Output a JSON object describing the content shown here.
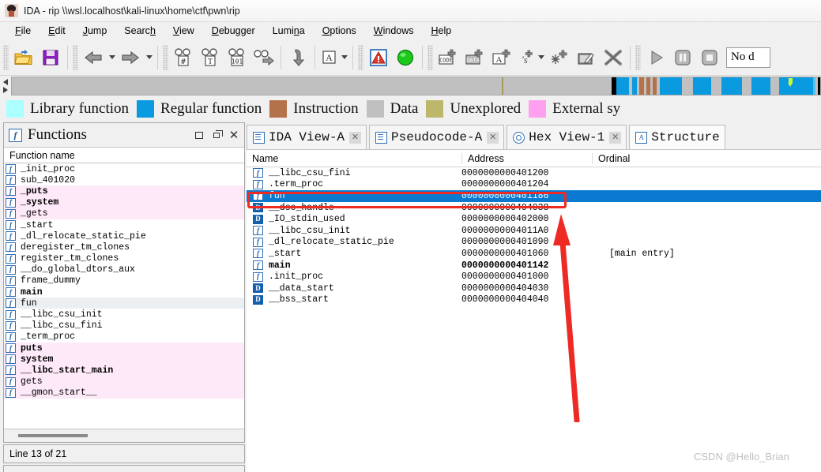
{
  "window": {
    "title": "IDA - rip \\\\wsl.localhost\\kali-linux\\home\\ctf\\pwn\\rip",
    "logo_icon": "ida-app-icon"
  },
  "menubar": [
    {
      "label": "File",
      "mnemonic": "F"
    },
    {
      "label": "Edit",
      "mnemonic": "E"
    },
    {
      "label": "Jump",
      "mnemonic": "J"
    },
    {
      "label": "Search",
      "mnemonic": "h"
    },
    {
      "label": "View",
      "mnemonic": "V"
    },
    {
      "label": "Debugger",
      "mnemonic": "D"
    },
    {
      "label": "Lumina",
      "mnemonic": "n"
    },
    {
      "label": "Options",
      "mnemonic": "O"
    },
    {
      "label": "Windows",
      "mnemonic": "W"
    },
    {
      "label": "Help",
      "mnemonic": "H"
    }
  ],
  "toolbar": {
    "buttons": [
      "open-file-icon",
      "save-file-icon",
      "navigate-back-icon",
      "navigate-forward-icon",
      "search-hex-icon",
      "search-text-icon",
      "search-immediate-icon",
      "search-next-icon",
      "jump-down-icon",
      "ascii-string-icon",
      "warning-icon",
      "green-run-icon",
      "make-code-icon",
      "make-data-icon",
      "make-ascii-icon",
      "make-struct-var-icon",
      "make-struct-icon",
      "edit-function-icon",
      "delete-icon",
      "run-icon",
      "pause-icon",
      "stop-icon"
    ],
    "debugger_selector": "No d"
  },
  "navigation": {
    "segments": [
      {
        "left": 0.0,
        "width": 60.6,
        "color": "#c0c0c0"
      },
      {
        "left": 60.6,
        "width": 0.25,
        "color": "#a89a5c"
      },
      {
        "left": 60.85,
        "width": 13.3,
        "color": "#c0c0c0"
      },
      {
        "left": 74.15,
        "width": 0.62,
        "color": "#000000"
      },
      {
        "left": 74.77,
        "width": 1.55,
        "color": "#0a9ae0"
      },
      {
        "left": 76.32,
        "width": 0.4,
        "color": "#c0c0c0"
      },
      {
        "left": 76.72,
        "width": 0.62,
        "color": "#0a9ae0"
      },
      {
        "left": 77.34,
        "width": 0.32,
        "color": "#c0c0c0"
      },
      {
        "left": 77.66,
        "width": 0.5,
        "color": "#b5714a"
      },
      {
        "left": 78.16,
        "width": 0.31,
        "color": "#c0c0c0"
      },
      {
        "left": 78.47,
        "width": 0.5,
        "color": "#b5714a"
      },
      {
        "left": 78.97,
        "width": 0.31,
        "color": "#c0c0c0"
      },
      {
        "left": 79.28,
        "width": 0.5,
        "color": "#b5714a"
      },
      {
        "left": 79.78,
        "width": 0.4,
        "color": "#c0c0c0"
      },
      {
        "left": 80.18,
        "width": 2.7,
        "color": "#0a9ae0"
      },
      {
        "left": 82.88,
        "width": 1.35,
        "color": "#c0c0c0"
      },
      {
        "left": 84.23,
        "width": 2.3,
        "color": "#0a9ae0"
      },
      {
        "left": 86.53,
        "width": 1.25,
        "color": "#c0c0c0"
      },
      {
        "left": 87.78,
        "width": 2.5,
        "color": "#0a9ae0"
      },
      {
        "left": 90.28,
        "width": 1.25,
        "color": "#c0c0c0"
      },
      {
        "left": 91.53,
        "width": 2.3,
        "color": "#0a9ae0"
      },
      {
        "left": 93.83,
        "width": 1.1,
        "color": "#c0c0c0"
      },
      {
        "left": 94.93,
        "width": 4.2,
        "color": "#0a9ae0"
      },
      {
        "left": 99.13,
        "width": 0.3,
        "color": "#4fc3f0"
      },
      {
        "left": 99.43,
        "width": 0.3,
        "color": "#c0c0c0"
      },
      {
        "left": 99.73,
        "width": 0.27,
        "color": "#000000"
      }
    ],
    "cursor_percent": 96.0,
    "tail_color": "#bdb76b",
    "tail_start_percent": 100.0
  },
  "legend": [
    {
      "label": "Library function",
      "color": "#aaffff"
    },
    {
      "label": "Regular function",
      "color": "#0a9ae0"
    },
    {
      "label": "Instruction",
      "color": "#b5714a"
    },
    {
      "label": "Data",
      "color": "#c0c0c0"
    },
    {
      "label": "Unexplored",
      "color": "#bdb76b"
    },
    {
      "label": "External sy",
      "color": "#ff9ff0"
    }
  ],
  "functions_panel": {
    "title": "Functions",
    "icon": "functions-window-icon",
    "column_header": "Function name",
    "window_buttons": [
      "minimize-button",
      "restore-button",
      "close-button"
    ],
    "items": [
      {
        "name": "_init_proc",
        "import": false,
        "bold": false,
        "selected": false
      },
      {
        "name": "sub_401020",
        "import": false,
        "bold": false,
        "selected": false
      },
      {
        "name": "_puts",
        "import": true,
        "bold": true,
        "selected": false
      },
      {
        "name": "_system",
        "import": true,
        "bold": true,
        "selected": false
      },
      {
        "name": "_gets",
        "import": true,
        "bold": false,
        "selected": false
      },
      {
        "name": "_start",
        "import": false,
        "bold": false,
        "selected": false
      },
      {
        "name": "_dl_relocate_static_pie",
        "import": false,
        "bold": false,
        "selected": false
      },
      {
        "name": "deregister_tm_clones",
        "import": false,
        "bold": false,
        "selected": false
      },
      {
        "name": "register_tm_clones",
        "import": false,
        "bold": false,
        "selected": false
      },
      {
        "name": "__do_global_dtors_aux",
        "import": false,
        "bold": false,
        "selected": false
      },
      {
        "name": "frame_dummy",
        "import": false,
        "bold": false,
        "selected": false
      },
      {
        "name": "main",
        "import": false,
        "bold": true,
        "selected": false
      },
      {
        "name": "fun",
        "import": false,
        "bold": false,
        "selected": true
      },
      {
        "name": "__libc_csu_init",
        "import": false,
        "bold": false,
        "selected": false
      },
      {
        "name": "__libc_csu_fini",
        "import": false,
        "bold": false,
        "selected": false
      },
      {
        "name": "_term_proc",
        "import": false,
        "bold": false,
        "selected": false
      },
      {
        "name": "puts",
        "import": true,
        "bold": true,
        "selected": false
      },
      {
        "name": "system",
        "import": true,
        "bold": true,
        "selected": false
      },
      {
        "name": "__libc_start_main",
        "import": true,
        "bold": true,
        "selected": false
      },
      {
        "name": "gets",
        "import": true,
        "bold": false,
        "selected": false
      },
      {
        "name": "__gmon_start__",
        "import": true,
        "bold": false,
        "selected": false
      }
    ],
    "status": "Line 13 of 21"
  },
  "tabs": [
    {
      "label": "IDA View-A",
      "icon": "ida-view-icon",
      "closable": true,
      "active": false
    },
    {
      "label": "Pseudocode-A",
      "icon": "pseudocode-icon",
      "closable": true,
      "active": false
    },
    {
      "label": "Hex View-1",
      "icon": "hex-view-icon",
      "closable": true,
      "active": false
    },
    {
      "label": "Structure",
      "icon": "structures-icon",
      "closable": false,
      "active": true
    }
  ],
  "names_table": {
    "columns": [
      "Name",
      "Address",
      "Ordinal"
    ],
    "rows": [
      {
        "icon": "function-icon",
        "name": "__libc_csu_fini",
        "address": "0000000000401200",
        "ordinal": "",
        "bold": false,
        "selected": false
      },
      {
        "icon": "function-icon",
        "name": ".term_proc",
        "address": "0000000000401204",
        "ordinal": "",
        "bold": false,
        "selected": false
      },
      {
        "icon": "function-icon",
        "name": "fun",
        "address": "0000000000401186",
        "ordinal": "",
        "bold": false,
        "selected": true
      },
      {
        "icon": "data-icon",
        "name": "__dso_handle",
        "address": "0000000000404038",
        "ordinal": "",
        "bold": false,
        "selected": false
      },
      {
        "icon": "data-icon",
        "name": "_IO_stdin_used",
        "address": "0000000000402000",
        "ordinal": "",
        "bold": false,
        "selected": false
      },
      {
        "icon": "function-icon",
        "name": "__libc_csu_init",
        "address": "00000000004011A0",
        "ordinal": "",
        "bold": false,
        "selected": false
      },
      {
        "icon": "function-icon",
        "name": "_dl_relocate_static_pie",
        "address": "0000000000401090",
        "ordinal": "",
        "bold": false,
        "selected": false
      },
      {
        "icon": "function-icon",
        "name": "_start",
        "address": "0000000000401060",
        "ordinal": "[main entry]",
        "bold": false,
        "selected": false
      },
      {
        "icon": "function-icon",
        "name": "main",
        "address": "0000000000401142",
        "ordinal": "",
        "bold": true,
        "selected": false
      },
      {
        "icon": "function-icon",
        "name": ".init_proc",
        "address": "0000000000401000",
        "ordinal": "",
        "bold": false,
        "selected": false
      },
      {
        "icon": "data-icon",
        "name": "__data_start",
        "address": "0000000000404030",
        "ordinal": "",
        "bold": false,
        "selected": false
      },
      {
        "icon": "data-icon",
        "name": "__bss_start",
        "address": "0000000000404040",
        "ordinal": "",
        "bold": false,
        "selected": false
      }
    ]
  },
  "annotations": {
    "highlight_color": "#ee2a24",
    "arrow_color": "#ee2a24",
    "watermark": "CSDN @Hello_Brian"
  }
}
